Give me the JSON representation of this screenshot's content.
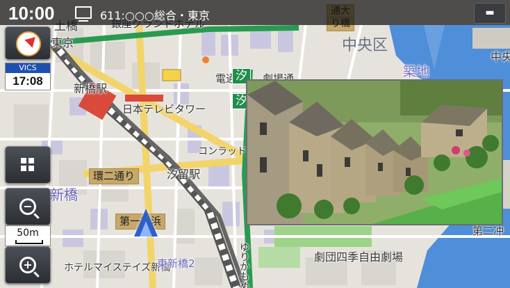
{
  "status_bar": {
    "time": "10:00",
    "channel": "611:○○○総合・東京",
    "tv_icon": "tv-icon",
    "menu_icon": "menu-icon"
  },
  "side_controls": {
    "compass_icon": "compass-icon",
    "vics_label": "VICS",
    "vics_time": "17:08",
    "grid_icon": "grid-menu-icon",
    "zoom_out_icon": "zoom-out-icon",
    "scale": "50m",
    "zoom_in_icon": "zoom-in-icon"
  },
  "map": {
    "labels": {
      "toubashi": "土橋",
      "ginza": "銀座グランドホテル",
      "touou": "東京",
      "shinbashi_station": "新橋駅",
      "ntv": "日本テレビタワー",
      "shiodome_station": "汐留駅",
      "conrad": "コンラッド東",
      "kan2": "環二通り",
      "shinbashi_big": "新橋",
      "daiichi_keihin": "第一京浜",
      "chuo_ku": "中央区",
      "tsukiji": "築地",
      "tsukiji_right": "築地",
      "naka": "中央",
      "gekidan": "劇団四季自由劇場",
      "hotel_mystays": "ホテルマイステイズ新橋",
      "higashi_shinbashi": "東新橋2",
      "yurikamome": "ゆりかもめ",
      "daini": "第二",
      "daini_right": "第二冲",
      "shiodome_tag": "汐",
      "shiodome_tag2": "汐",
      "dentsu": "電通",
      "tsukiji_mark": "劇場通",
      "toranomon": "通大",
      "tori": "り橋"
    }
  },
  "video": {
    "scene": "cottages-village-video"
  }
}
